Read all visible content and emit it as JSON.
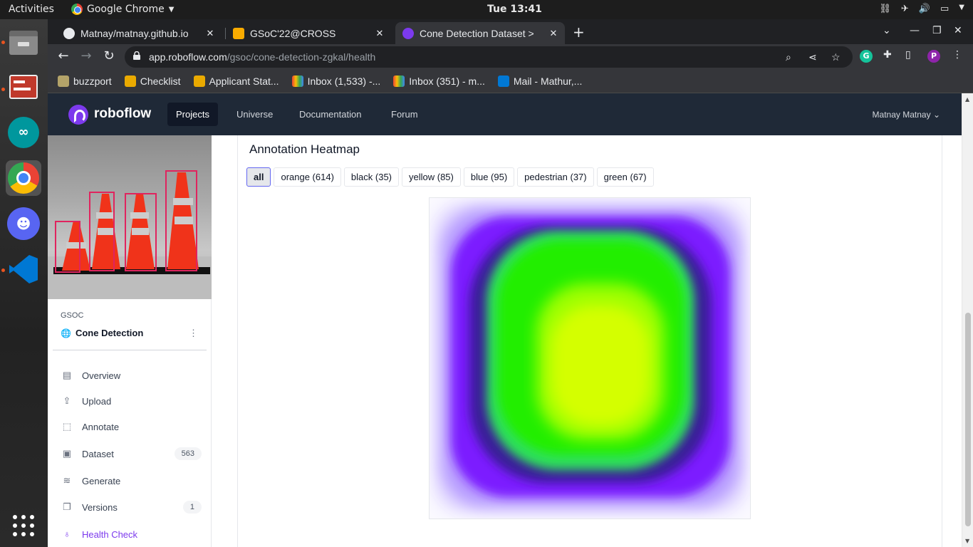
{
  "system": {
    "activities": "Activities",
    "app_name": "Google Chrome",
    "clock": "Tue 13:41"
  },
  "tabs": [
    {
      "label": "Matnay/matnay.github.io",
      "icon": "github-icon"
    },
    {
      "label": "GSoC'22@CROSS",
      "icon": "gsoc-icon"
    },
    {
      "label": "Cone Detection Dataset >",
      "icon": "roboflow-icon"
    }
  ],
  "address": {
    "host": "app.roboflow.com",
    "path": "/gsoc/cone-detection-zgkal/health"
  },
  "bookmarks": [
    {
      "label": "buzzport",
      "icon": "buzzport-icon"
    },
    {
      "label": "Checklist",
      "icon": "checklist-icon"
    },
    {
      "label": "Applicant Stat...",
      "icon": "applicant-icon"
    },
    {
      "label": "Inbox (1,533) -...",
      "icon": "gmail-icon"
    },
    {
      "label": "Inbox (351) - m...",
      "icon": "gmail-icon"
    },
    {
      "label": "Mail - Mathur,...",
      "icon": "outlook-icon"
    }
  ],
  "roboflow": {
    "brand": "roboflow",
    "nav": [
      "Projects",
      "Universe",
      "Documentation",
      "Forum"
    ],
    "user": "Matnay Matnay"
  },
  "sidebar": {
    "workspace": "GSOC",
    "project": "Cone Detection",
    "items": [
      {
        "label": "Overview",
        "count": ""
      },
      {
        "label": "Upload",
        "count": ""
      },
      {
        "label": "Annotate",
        "count": ""
      },
      {
        "label": "Dataset",
        "count": "563"
      },
      {
        "label": "Generate",
        "count": ""
      },
      {
        "label": "Versions",
        "count": "1"
      },
      {
        "label": "Health Check",
        "count": ""
      }
    ]
  },
  "main": {
    "title": "Annotation Heatmap",
    "filters": [
      "all",
      "orange (614)",
      "black (35)",
      "yellow (85)",
      "blue (95)",
      "pedestrian (37)",
      "green (67)"
    ],
    "active_filter": "all"
  },
  "colors": {
    "accent": "#7c3aed",
    "nav_bg": "#1f2937",
    "heat_low": "#7b1fff",
    "heat_mid": "#22ee00",
    "heat_high": "#d4ff00"
  }
}
